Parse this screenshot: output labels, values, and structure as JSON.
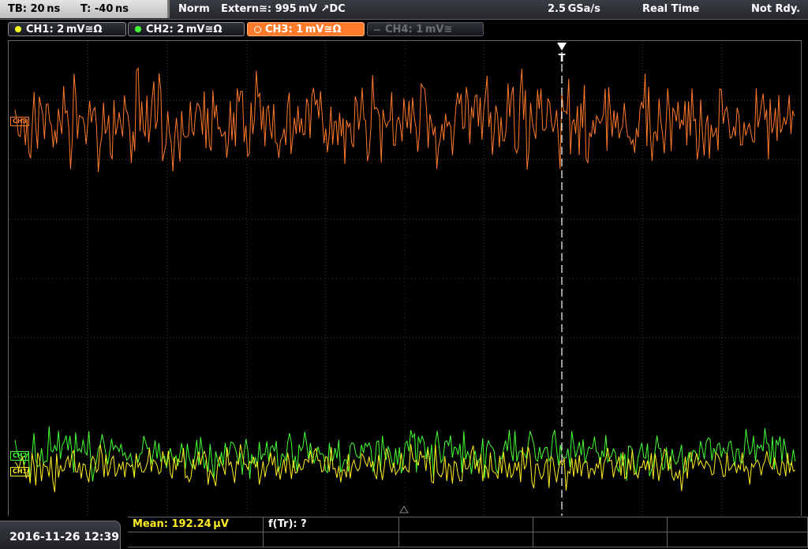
{
  "top": {
    "timebase": "TB: 20 ns",
    "trigger_pos": "T: -40 ns",
    "mode": "Norm",
    "trigger_source": "Extern≅: 995 mV ↗DC",
    "sample_rate": "2.5 GSa/s",
    "acq_mode": "Real Time",
    "status": "Not Rdy."
  },
  "channels": [
    {
      "label": "CH1: 2 mV≅Ω",
      "color": "#ffff22",
      "state": "on"
    },
    {
      "label": "CH2: 2 mV≅Ω",
      "color": "#44ff33",
      "state": "on"
    },
    {
      "label": "CH3: 1 mV≅Ω",
      "color": "#ff7a2a",
      "state": "active"
    },
    {
      "label": "CH4: 1 mV≅",
      "color": "#6d6f75",
      "state": "off"
    }
  ],
  "markers": {
    "trigger_label": "T",
    "ch1_marker": "CH1",
    "ch2_marker": "CH2",
    "ch3_marker": "CH3"
  },
  "colors": {
    "ch1": "#ffee22",
    "ch2": "#44ff33",
    "ch3": "#ff7a2a",
    "grid": "#3c3c3c"
  },
  "bottom": {
    "datetime": "2016-11-26 12:39",
    "meas1": "Mean: 192.24 µV",
    "meas2": "f(Tr): ?"
  }
}
